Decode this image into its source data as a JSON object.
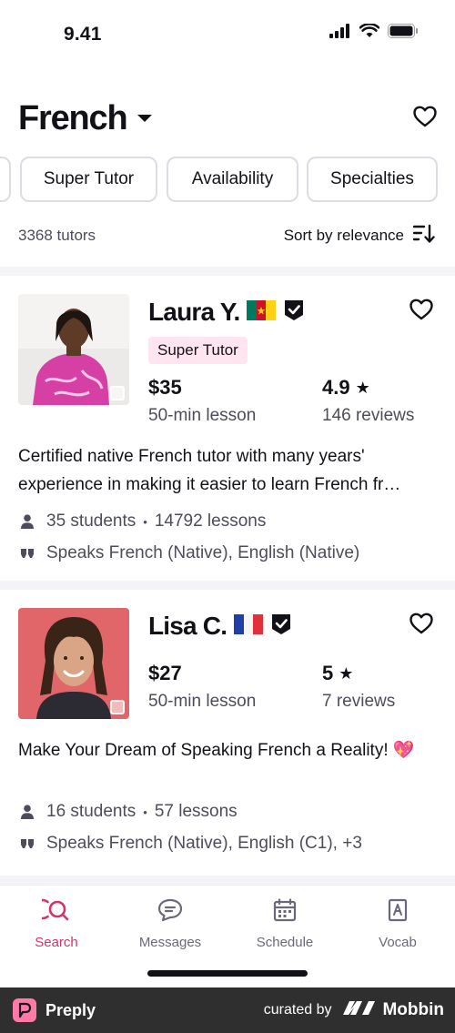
{
  "status_bar": {
    "time": "9.41"
  },
  "header": {
    "title": "French"
  },
  "filters": [
    "Super Tutor",
    "Availability",
    "Specialties"
  ],
  "results": {
    "count": "3368 tutors",
    "sort_label": "Sort by relevance"
  },
  "tutors": [
    {
      "name": "Laura Y.",
      "flag": "Cameroon",
      "badge": "Super Tutor",
      "price": "$35",
      "price_label": "50-min lesson",
      "rating": "4.9",
      "reviews": "146 reviews",
      "headline": "Certified native French tutor with many years' experience in making it easier to learn French fr…",
      "students": "35 students",
      "lessons": "14792 lessons",
      "speaks": "Speaks French (Native), English (Native)"
    },
    {
      "name": "Lisa C.",
      "flag": "France",
      "price": "$27",
      "price_label": "50-min lesson",
      "rating": "5",
      "reviews": "7 reviews",
      "headline": "Make Your Dream of Speaking French a Reality! 💖",
      "students": "16 students",
      "lessons": "57 lessons",
      "speaks": "Speaks French (Native), English (C1), +3"
    }
  ],
  "bottom_nav": [
    {
      "label": "Search",
      "icon": "search-icon",
      "active": true
    },
    {
      "label": "Messages",
      "icon": "message-icon",
      "active": false
    },
    {
      "label": "Schedule",
      "icon": "calendar-icon",
      "active": false
    },
    {
      "label": "Vocab",
      "icon": "vocab-icon",
      "active": false
    }
  ],
  "footer": {
    "brand": "Preply",
    "curated_by": "curated by",
    "curator": "Mobbin"
  },
  "colors": {
    "accent": "#d4336c",
    "badge_bg": "#ffe5ef",
    "text": "#121117",
    "muted": "#4d4c5c"
  }
}
